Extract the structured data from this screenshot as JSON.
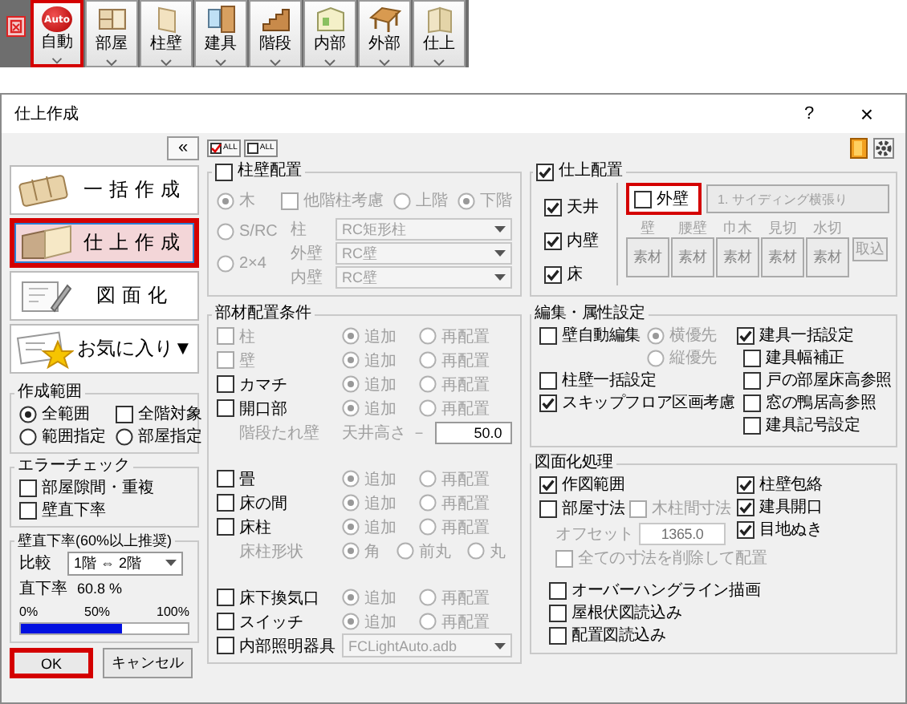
{
  "toolbar": {
    "items": [
      {
        "label": "自動",
        "badge": "Auto",
        "highlighted": true
      },
      {
        "label": "部屋",
        "highlighted": false
      },
      {
        "label": "柱壁",
        "highlighted": false
      },
      {
        "label": "建具",
        "highlighted": false
      },
      {
        "label": "階段",
        "highlighted": false
      },
      {
        "label": "内部",
        "highlighted": false
      },
      {
        "label": "外部",
        "highlighted": false
      },
      {
        "label": "仕上",
        "highlighted": false
      }
    ]
  },
  "dialog": {
    "title": "仕上作成",
    "help": "?",
    "close": "×"
  },
  "sidebar": {
    "collapse": "«",
    "modes": [
      {
        "label": "一括作成",
        "selected": false,
        "highlighted": false
      },
      {
        "label": "仕上作成",
        "selected": true,
        "highlighted": true
      },
      {
        "label": "図面化",
        "selected": false,
        "highlighted": false
      },
      {
        "label": "お気に入り▼",
        "selected": false,
        "highlighted": false
      }
    ],
    "range": {
      "title": "作成範囲",
      "options": [
        {
          "label": "全範囲",
          "selected": true
        },
        {
          "label": "範囲指定",
          "selected": false
        },
        {
          "label": "部屋指定",
          "selected": false
        }
      ],
      "all_floors": {
        "label": "全階対象",
        "checked": false
      }
    },
    "error_check": {
      "title": "エラーチェック",
      "items": [
        {
          "label": "部屋隙間・重複",
          "checked": false
        },
        {
          "label": "壁直下率",
          "checked": false
        }
      ]
    },
    "wall_ratio": {
      "title": "壁直下率(60%以上推奨)",
      "compare_label": "比較",
      "compare_value": "1階 ⇔ 2階",
      "ratio_label": "直下率",
      "ratio_value": "60.8 %",
      "ticks": [
        "0%",
        "50%",
        "100%"
      ],
      "level": 0.608
    }
  },
  "buttons": [
    {
      "label": "OK",
      "highlighted": true
    },
    {
      "label": "キャンセル",
      "highlighted": false
    }
  ],
  "all_buttons": [
    {
      "label": "ALL",
      "checked": true
    },
    {
      "label": "ALL",
      "checked": false
    }
  ],
  "column_wall": {
    "title": "柱壁配置",
    "checked": false,
    "structures": [
      {
        "label": "木",
        "selected": true
      },
      {
        "label": "S/RC",
        "selected": false
      },
      {
        "label": "2×4",
        "selected": false
      }
    ],
    "other_floor": {
      "label": "他階柱考慮",
      "checked": false
    },
    "floors": [
      {
        "label": "上階",
        "selected": false
      },
      {
        "label": "下階",
        "selected": true
      }
    ],
    "selects": [
      {
        "label": "柱",
        "value": "RC矩形柱"
      },
      {
        "label": "外壁",
        "value": "RC壁"
      },
      {
        "label": "内壁",
        "value": "RC壁"
      }
    ]
  },
  "members": {
    "title": "部材配置条件",
    "sections": [
      [
        {
          "kind": "member",
          "label": "柱",
          "checked": false,
          "disabled": true,
          "options": [
            {
              "label": "追加",
              "selected": true
            },
            {
              "label": "再配置",
              "selected": false
            }
          ]
        },
        {
          "kind": "member",
          "label": "壁",
          "checked": false,
          "disabled": true,
          "options": [
            {
              "label": "追加",
              "selected": true
            },
            {
              "label": "再配置",
              "selected": false
            }
          ]
        },
        {
          "kind": "member",
          "label": "カマチ",
          "checked": false,
          "disabled": false,
          "options": [
            {
              "label": "追加",
              "selected": true
            },
            {
              "label": "再配置",
              "selected": false
            }
          ]
        },
        {
          "kind": "member",
          "label": "開口部",
          "checked": false,
          "disabled": false,
          "options": [
            {
              "label": "追加",
              "selected": true
            },
            {
              "label": "再配置",
              "selected": false
            }
          ]
        },
        {
          "kind": "height",
          "label": "階段たれ壁",
          "field_label": "天井高さ －",
          "value": "50.0",
          "disabled": true
        }
      ],
      [
        {
          "kind": "member",
          "label": "畳",
          "checked": false,
          "disabled": false,
          "options": [
            {
              "label": "追加",
              "selected": true
            },
            {
              "label": "再配置",
              "selected": false
            }
          ]
        },
        {
          "kind": "member",
          "label": "床の間",
          "checked": false,
          "disabled": false,
          "options": [
            {
              "label": "追加",
              "selected": true
            },
            {
              "label": "再配置",
              "selected": false
            }
          ]
        },
        {
          "kind": "member",
          "label": "床柱",
          "checked": false,
          "disabled": false,
          "options": [
            {
              "label": "追加",
              "selected": true
            },
            {
              "label": "再配置",
              "selected": false
            }
          ]
        },
        {
          "kind": "shape",
          "label": "床柱形状",
          "disabled": true,
          "options": [
            {
              "label": "角",
              "selected": true
            },
            {
              "label": "前丸",
              "selected": false
            },
            {
              "label": "丸",
              "selected": false
            }
          ]
        }
      ],
      [
        {
          "kind": "member",
          "label": "床下換気口",
          "checked": false,
          "disabled": false,
          "options": [
            {
              "label": "追加",
              "selected": true
            },
            {
              "label": "再配置",
              "selected": false
            }
          ]
        },
        {
          "kind": "member",
          "label": "スイッチ",
          "checked": false,
          "disabled": false,
          "options": [
            {
              "label": "追加",
              "selected": true
            },
            {
              "label": "再配置",
              "selected": false
            }
          ]
        },
        {
          "kind": "fixture",
          "label": "内部照明器具",
          "checked": false,
          "value": "FCLightAuto.adb"
        }
      ]
    ]
  },
  "finish": {
    "title": "仕上配置",
    "checked": true,
    "parts": [
      {
        "label": "天井",
        "checked": true
      },
      {
        "label": "内壁",
        "checked": true
      },
      {
        "label": "床",
        "checked": true
      }
    ],
    "exterior": {
      "label": "外壁",
      "checked": false,
      "highlighted": true,
      "button": "1. サイディング横張り"
    },
    "materials": [
      {
        "label": "壁",
        "button": "素材",
        "disabled": true
      },
      {
        "label": "腰壁",
        "button": "素材",
        "disabled": true
      },
      {
        "label": "巾木",
        "button": "素材",
        "disabled": true
      },
      {
        "label": "見切",
        "button": "素材",
        "disabled": true
      },
      {
        "label": "水切",
        "button": "素材",
        "disabled": true
      }
    ],
    "import_button": {
      "label": "取込",
      "disabled": true
    }
  },
  "edit": {
    "title": "編集・属性設定",
    "left": [
      {
        "label": "壁自動編集",
        "checked": false,
        "options": [
          {
            "label": "横優先",
            "selected": true
          },
          {
            "label": "縦優先",
            "selected": false
          }
        ]
      },
      {
        "label": "柱壁一括設定",
        "checked": false
      },
      {
        "label": "スキップフロア区画考慮",
        "checked": true
      }
    ],
    "right": [
      {
        "label": "建具一括設定",
        "checked": true,
        "children": [
          {
            "label": "建具幅補正",
            "checked": false
          },
          {
            "label": "戸の部屋床高参照",
            "checked": false
          },
          {
            "label": "窓の鴨居高参照",
            "checked": false
          },
          {
            "label": "建具記号設定",
            "checked": false
          }
        ]
      }
    ]
  },
  "drawing": {
    "title": "図面化処理",
    "left": [
      {
        "label": "作図範囲",
        "checked": true
      },
      {
        "label": "部屋寸法",
        "checked": false,
        "sub": {
          "label": "木柱間寸法",
          "checked": false
        },
        "offset": {
          "label": "オフセット",
          "value": "1365.0"
        },
        "delete_all": {
          "label": "全ての寸法を削除して配置",
          "checked": false
        }
      }
    ],
    "right": [
      {
        "label": "柱壁包絡",
        "checked": true
      },
      {
        "label": "建具開口",
        "checked": true
      },
      {
        "label": "目地ぬき",
        "checked": true
      }
    ],
    "extra": [
      {
        "label": "オーバーハングライン描画",
        "checked": false
      },
      {
        "label": "屋根伏図読込み",
        "checked": false
      },
      {
        "label": "配置図読込み",
        "checked": false
      }
    ]
  }
}
